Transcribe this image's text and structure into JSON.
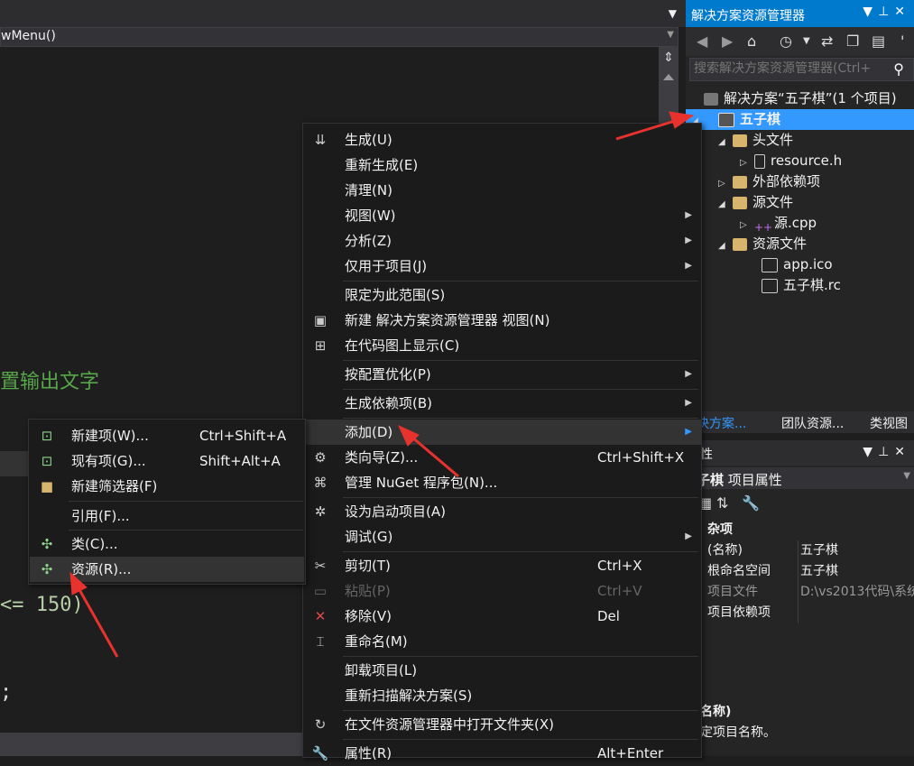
{
  "editor": {
    "member_combo": "wMenu()",
    "code_comment": "置输出文字",
    "code_condition": "<= 150)",
    "code_semicolon": ";"
  },
  "solution_explorer": {
    "title": "解决方案资源管理器",
    "search_placeholder": "搜索解决方案资源管理器(Ctrl+",
    "tree": [
      {
        "label": "解决方案“五子棋”(1 个项目)",
        "icon": "solution-icon"
      },
      {
        "label": "五子棋",
        "icon": "project-icon",
        "selected": true
      },
      {
        "label": "头文件",
        "icon": "folder-icon"
      },
      {
        "label": "resource.h",
        "icon": "header-file-icon"
      },
      {
        "label": "外部依赖项",
        "icon": "folder-icon"
      },
      {
        "label": "源文件",
        "icon": "folder-icon"
      },
      {
        "label": "源.cpp",
        "icon": "cpp-file-icon"
      },
      {
        "label": "资源文件",
        "icon": "folder-icon"
      },
      {
        "label": "app.ico",
        "icon": "image-file-icon"
      },
      {
        "label": "五子棋.rc",
        "icon": "rc-file-icon"
      }
    ],
    "tabs": [
      "决方案...",
      "团队资源...",
      "类视图"
    ]
  },
  "properties": {
    "title": "性",
    "object": "子棋",
    "object_type": "项目属性",
    "category": "杂项",
    "rows": [
      {
        "key": "(名称)",
        "value": "五子棋"
      },
      {
        "key": "根命名空间",
        "value": "五子棋"
      },
      {
        "key": "项目文件",
        "value": "D:\\vs2013代码\\系统",
        "dim": true
      },
      {
        "key": "项目依赖项",
        "value": ""
      }
    ],
    "desc_title": "名称)",
    "desc_text": "定项目名称。"
  },
  "context_menu": {
    "items": [
      {
        "label": "生成(U)",
        "icon": "build-icon"
      },
      {
        "label": "重新生成(E)"
      },
      {
        "label": "清理(N)"
      },
      {
        "label": "视图(W)",
        "submenu": true
      },
      {
        "label": "分析(Z)",
        "submenu": true
      },
      {
        "label": "仅用于项目(J)",
        "submenu": true
      },
      {
        "label": "限定为此范围(S)"
      },
      {
        "label": "新建 解决方案资源管理器 视图(N)",
        "icon": "new-view-icon"
      },
      {
        "label": "在代码图上显示(C)",
        "icon": "code-map-icon"
      },
      {
        "label": "按配置优化(P)",
        "submenu": true
      },
      {
        "label": "生成依赖项(B)",
        "submenu": true
      },
      {
        "label": "添加(D)",
        "submenu": true,
        "highlighted": true
      },
      {
        "label": "类向导(Z)...",
        "shortcut": "Ctrl+Shift+X",
        "icon": "class-wizard-icon"
      },
      {
        "label": "管理 NuGet 程序包(N)...",
        "icon": "nuget-icon"
      },
      {
        "label": "设为启动项目(A)",
        "icon": "gear-icon"
      },
      {
        "label": "调试(G)",
        "submenu": true
      },
      {
        "label": "剪切(T)",
        "shortcut": "Ctrl+X",
        "icon": "scissors-icon"
      },
      {
        "label": "粘贴(P)",
        "shortcut": "Ctrl+V",
        "icon": "paste-icon",
        "disabled": true
      },
      {
        "label": "移除(V)",
        "shortcut": "Del",
        "icon": "remove-icon"
      },
      {
        "label": "重命名(M)",
        "icon": "rename-icon"
      },
      {
        "label": "卸载项目(L)"
      },
      {
        "label": "重新扫描解决方案(S)"
      },
      {
        "label": "在文件资源管理器中打开文件夹(X)",
        "icon": "refresh-icon"
      },
      {
        "label": "属性(R)",
        "shortcut": "Alt+Enter",
        "icon": "wrench-icon"
      }
    ]
  },
  "add_submenu": {
    "items": [
      {
        "label": "新建项(W)...",
        "shortcut": "Ctrl+Shift+A",
        "icon": "new-item-icon"
      },
      {
        "label": "现有项(G)...",
        "shortcut": "Shift+Alt+A",
        "icon": "existing-item-icon"
      },
      {
        "label": "新建筛选器(F)",
        "icon": "folder-icon"
      },
      {
        "label": "引用(F)..."
      },
      {
        "label": "类(C)...",
        "icon": "class-icon"
      },
      {
        "label": "资源(R)...",
        "icon": "resource-icon",
        "highlighted": true
      }
    ]
  }
}
